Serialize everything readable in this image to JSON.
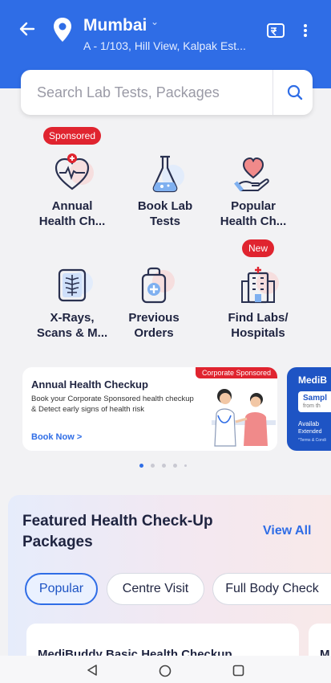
{
  "header": {
    "city": "Mumbai",
    "address": "A - 1/103, Hill View, Kalpak Est..."
  },
  "search": {
    "placeholder": "Search Lab Tests, Packages"
  },
  "categories": {
    "sponsored_badge": "Sponsored",
    "new_badge": "New",
    "items": [
      {
        "line1": "Annual",
        "line2": "Health Ch...",
        "icon": "heart-pulse-icon"
      },
      {
        "line1": "Book Lab",
        "line2": "Tests",
        "icon": "lab-flask-icon"
      },
      {
        "line1": "Popular",
        "line2": "Health Ch...",
        "icon": "hand-heart-icon"
      },
      {
        "line1": "X-Rays,",
        "line2": "Scans & M...",
        "icon": "xray-ribcage-icon"
      },
      {
        "line1": "Previous",
        "line2": "Orders",
        "icon": "medical-bag-icon"
      },
      {
        "line1": "Find Labs/",
        "line2": "Hospitals",
        "icon": "hospital-building-icon"
      }
    ]
  },
  "banner": {
    "tag": "Corporate Sponsored",
    "title": "Annual Health Checkup",
    "text": "Book your Corporate Sponsored health checkup & Detect early signs of health risk",
    "link": "Book Now >"
  },
  "banner2": {
    "title": "MediB",
    "box_line1": "Sampl",
    "box_line2": "from th",
    "line1": "Availab",
    "line2": "Extended",
    "line3": "*Terms & Condi"
  },
  "featured": {
    "title": "Featured Health Check-Up Packages",
    "view_all": "View All",
    "chips": [
      "Popular",
      "Centre Visit",
      "Full Body Check"
    ],
    "card1_title": "MediBuddy  Basic Health Checkup",
    "card2_title": "M"
  },
  "colors": {
    "primary": "#2f6de6",
    "badge_red": "#e0242f",
    "text_dark": "#1f2440"
  }
}
